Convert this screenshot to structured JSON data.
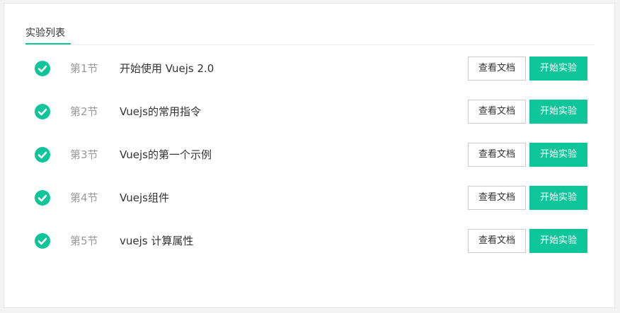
{
  "tab": {
    "label": "实验列表"
  },
  "colors": {
    "accent": "#0fc59a",
    "muted_text": "#999999",
    "text": "#333333"
  },
  "labs": [
    {
      "section": "第1节",
      "title": "开始使用 Vuejs 2.0",
      "completed": true,
      "docs_label": "查看文档",
      "start_label": "开始实验"
    },
    {
      "section": "第2节",
      "title": "Vuejs的常用指令",
      "completed": true,
      "docs_label": "查看文档",
      "start_label": "开始实验"
    },
    {
      "section": "第3节",
      "title": "Vuejs的第一个示例",
      "completed": true,
      "docs_label": "查看文档",
      "start_label": "开始实验"
    },
    {
      "section": "第4节",
      "title": "Vuejs组件",
      "completed": true,
      "docs_label": "查看文档",
      "start_label": "开始实验"
    },
    {
      "section": "第5节",
      "title": "vuejs 计算属性",
      "completed": true,
      "docs_label": "查看文档",
      "start_label": "开始实验"
    }
  ]
}
